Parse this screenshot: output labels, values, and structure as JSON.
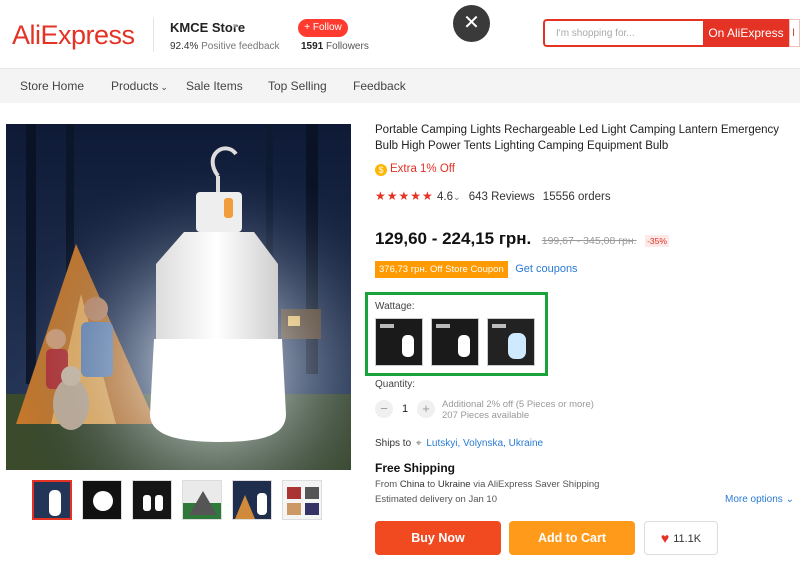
{
  "header": {
    "logo": "AliExpress",
    "store_name": "KMCE Store",
    "feedback_pct": "92.4%",
    "feedback_label": " Positive feedback",
    "follow_label": "+ Follow",
    "followers_count": "1591",
    "followers_label": " Followers",
    "close_glyph": "✕",
    "search_placeholder": "I'm shopping for...",
    "search_button": "On AliExpress",
    "search_button2": "I"
  },
  "nav": {
    "items": [
      "Store Home",
      "Products",
      "Sale Items",
      "Top Selling",
      "Feedback"
    ],
    "caret": "⌄"
  },
  "product": {
    "title": "Portable Camping Lights Rechargeable Led Light Camping Lantern Emergency Bulb High Power Tents Lighting Camping Equipment Bulb",
    "extra_off": "Extra 1% Off",
    "extra_off_icon": "coin-icon",
    "stars": "★★★★★",
    "rating": "4.6",
    "rating_caret": "⌄",
    "reviews": "643 Reviews",
    "orders": "15556 orders",
    "price": "129,60 - 224,15 грн.",
    "old_price": "199,67 - 345,08 грн.",
    "discount": "-35%",
    "coupon": "376,73 грн. Off Store Coupon",
    "get_coupons": "Get coupons",
    "variant_label": "Wattage:",
    "qty_label": "Quantity:",
    "qty_minus": "−",
    "qty_value": "1",
    "qty_plus": "+",
    "qty_info_1": "Additional 2% off (5 Pieces or more)",
    "qty_info_2": "207 Pieces available",
    "ships_to_label": "Ships to",
    "ships_to_location": "Lutskyi, Volynska, Ukraine",
    "free_shipping": "Free Shipping",
    "from_prefix": "From ",
    "from_country": "China",
    "to_word": " to ",
    "to_country": "Ukraine",
    "via_text": " via AliExpress Saver Shipping",
    "estimated_delivery": "Estimated delivery on Jan 10",
    "more_options": "More options",
    "more_options_caret": "⌄",
    "buy_now": "Buy Now",
    "add_to_cart": "Add to Cart",
    "wishlist_count": "11.1K"
  },
  "colors": {
    "brand_red": "#e43225",
    "buy_now": "#f24a20",
    "add_to_cart": "#ff9a1a",
    "highlight_box": "#19a33a",
    "link": "#2b7bd3"
  }
}
